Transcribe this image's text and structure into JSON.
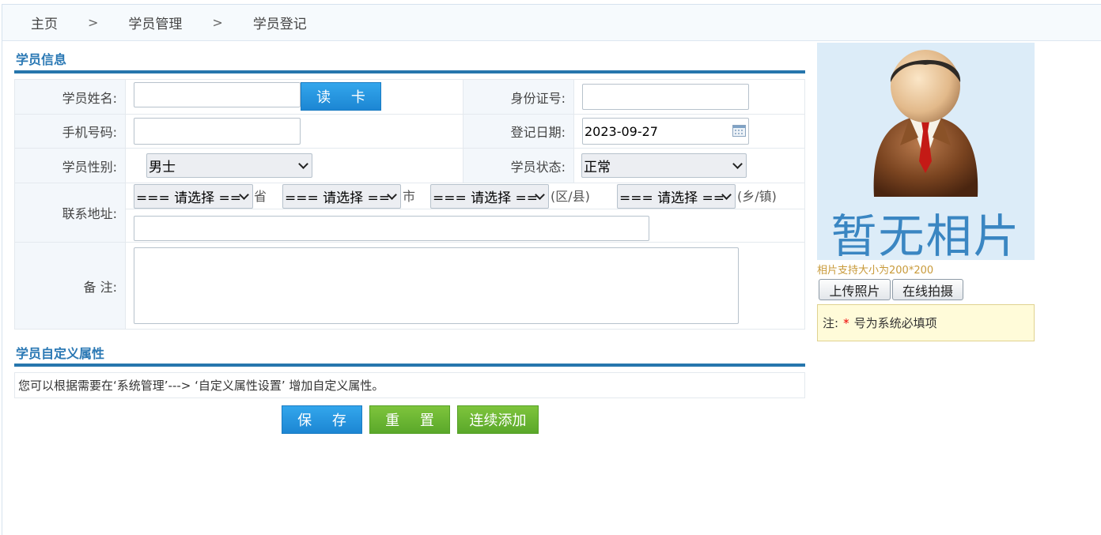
{
  "breadcrumb": {
    "items": [
      "主页",
      "学员管理",
      "学员登记"
    ],
    "separator": ">"
  },
  "sections": {
    "info_title": "学员信息",
    "custom_title": "学员自定义属性"
  },
  "form": {
    "name_label": "学员姓名:",
    "name_value": "",
    "read_card_button": "读 卡",
    "id_label": "身份证号:",
    "id_value": "",
    "phone_label": "手机号码:",
    "phone_value": "",
    "date_label": "登记日期:",
    "date_value": "2023-09-27",
    "gender_label": "学员性别:",
    "gender_value": "男士",
    "status_label": "学员状态:",
    "status_value": "正常",
    "address_label": "联系地址:",
    "province_value": "=== 请选择 ==",
    "province_suffix": "省",
    "city_value": "=== 请选择 ==",
    "city_suffix": "市",
    "district_value": "=== 请选择 ==",
    "district_suffix": "(区/县)",
    "town_value": "=== 请选择 ==",
    "town_suffix": "(乡/镇)",
    "address_detail": "",
    "remark_label": "备 注:",
    "remark_value": ""
  },
  "custom": {
    "hint": "您可以根据需要在‘系统管理’---> ‘自定义属性设置’ 增加自定义属性。"
  },
  "actions": {
    "save": "保 存",
    "reset": "重 置",
    "continue_add": "连续添加"
  },
  "photo": {
    "placeholder_text": "暂无相片",
    "size_hint": "相片支持大小为200*200",
    "upload_button": "上传照片",
    "capture_button": "在线拍摄"
  },
  "note": {
    "prefix": "注:",
    "star": "*",
    "text": "号为系统必填项"
  },
  "colors": {
    "accent": "#2676ad",
    "title": "#2a78b4",
    "button_blue": "#1c86d3",
    "button_green": "#5aa82a",
    "hint": "#c89a3a"
  }
}
